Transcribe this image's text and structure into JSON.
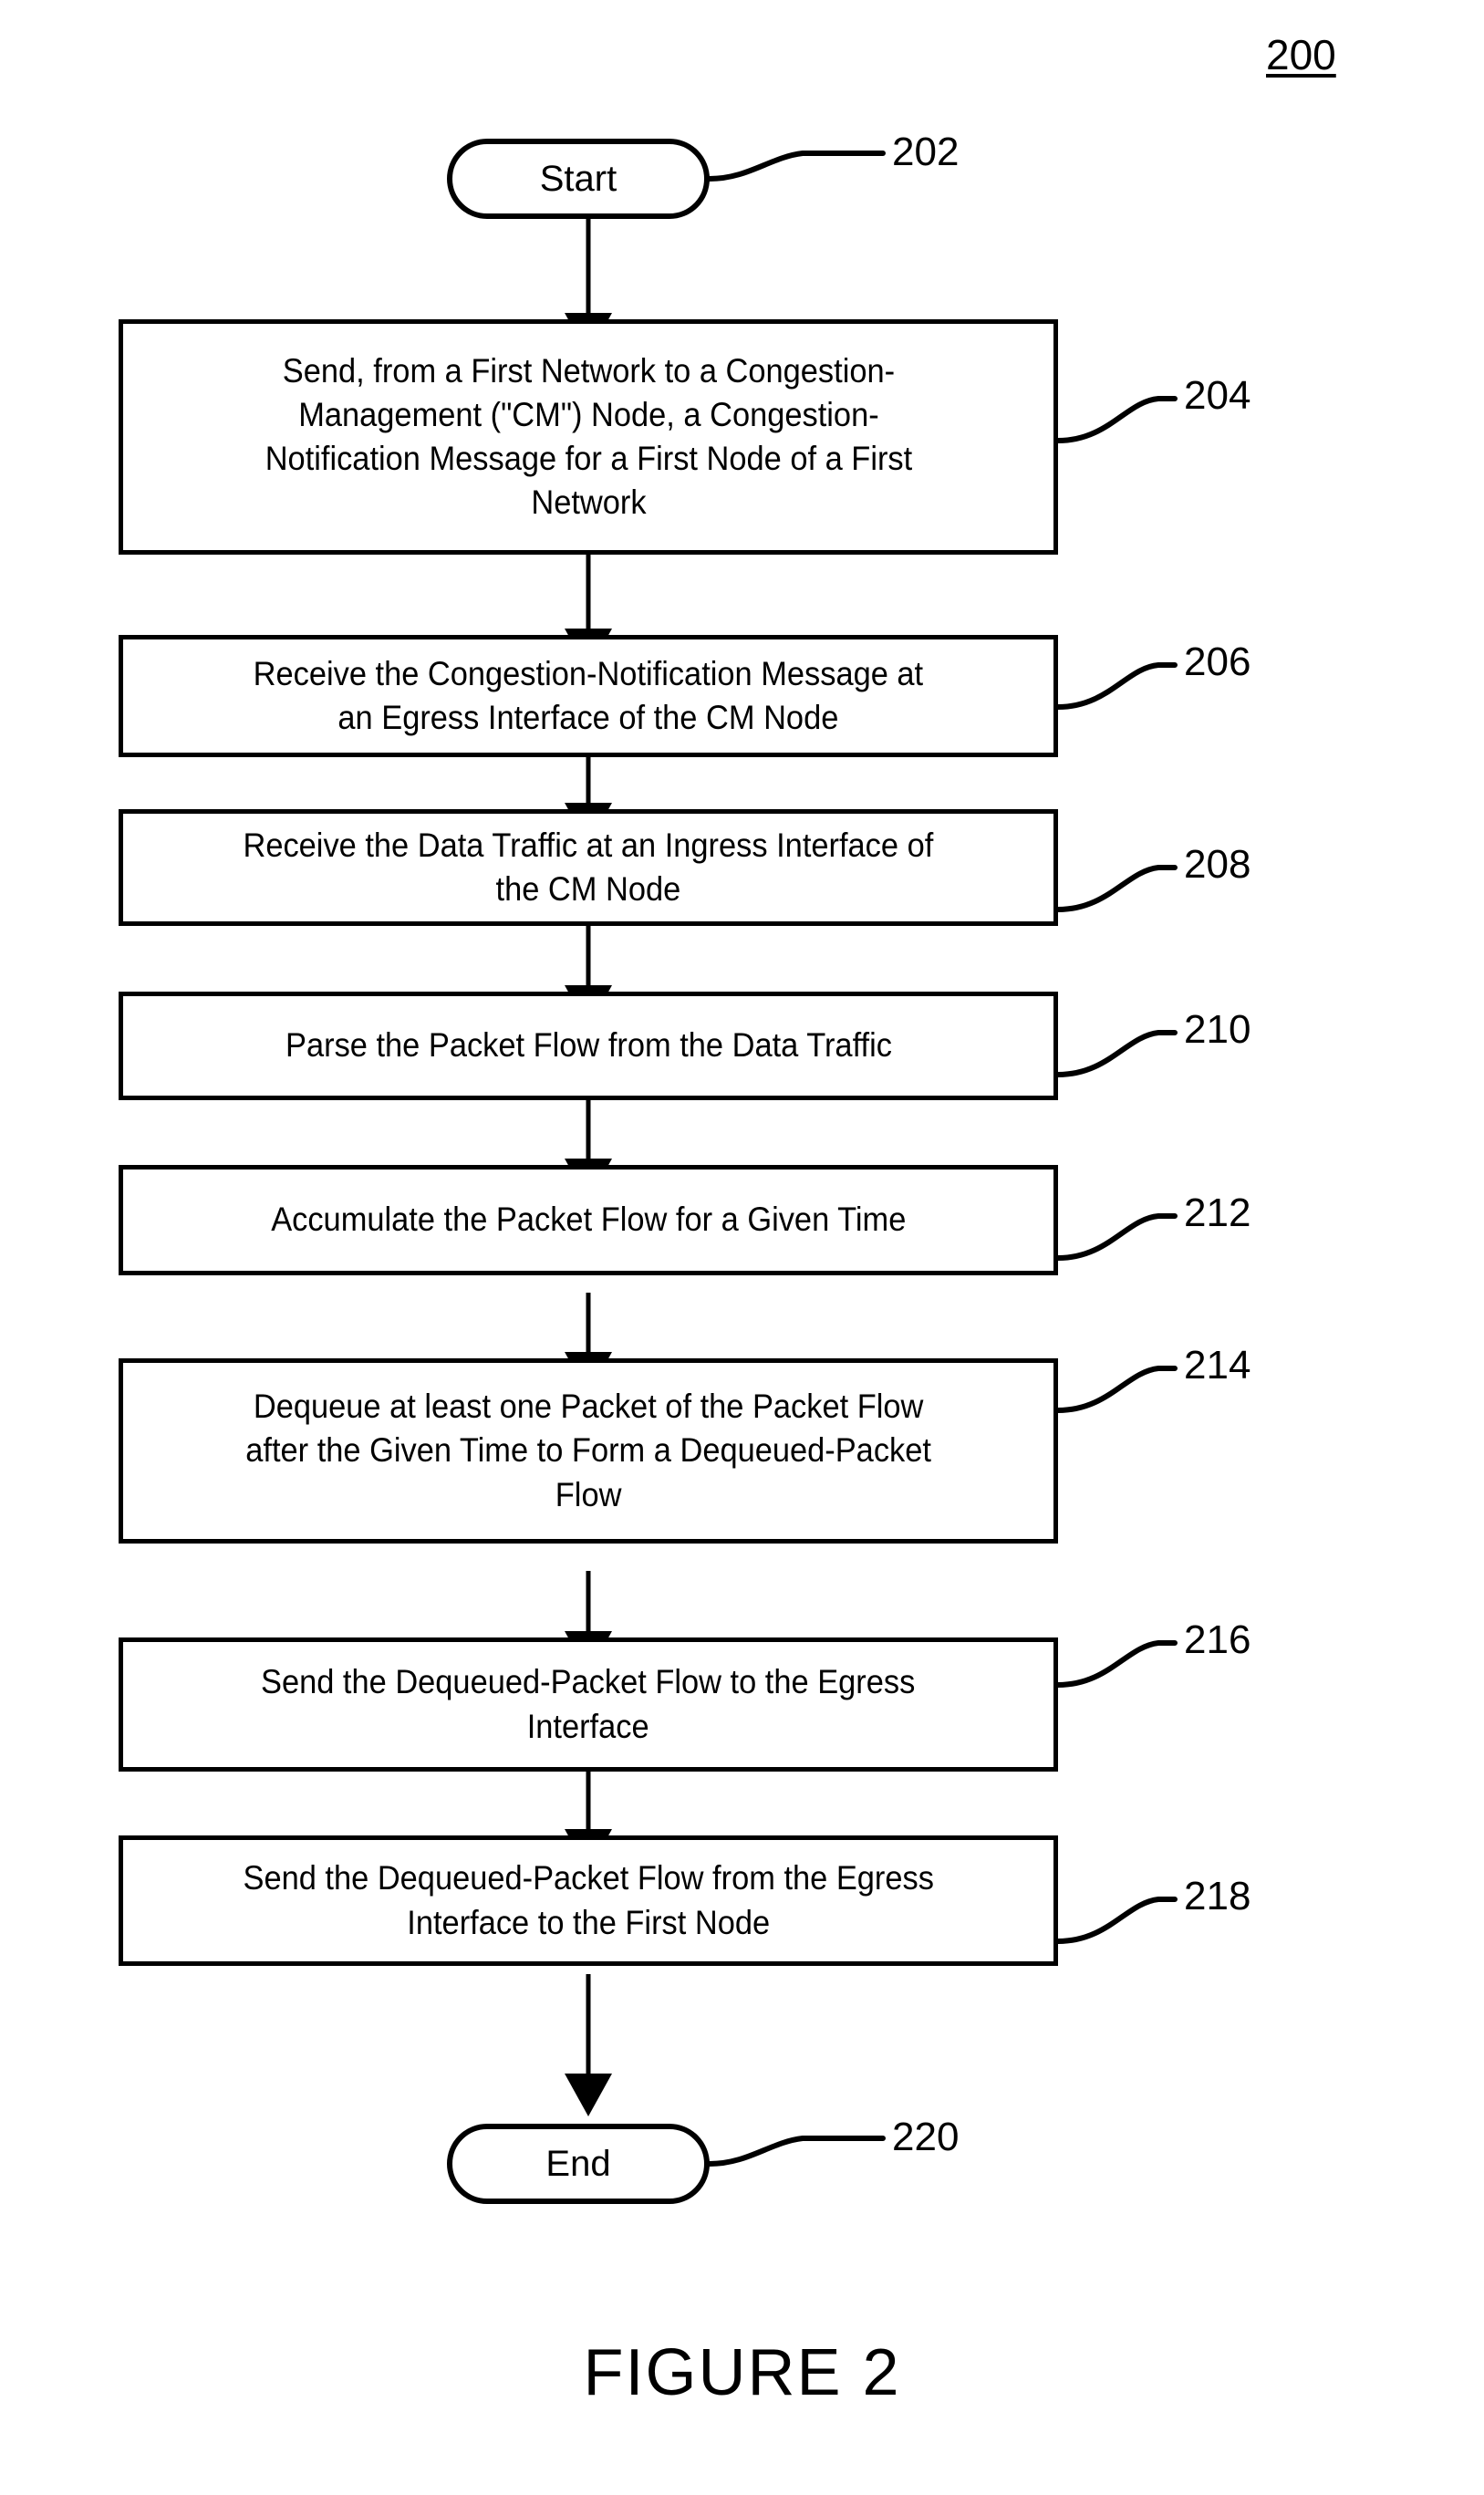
{
  "figure": {
    "number_label": "200",
    "caption": "FIGURE 2"
  },
  "nodes": {
    "start": {
      "label": "Start",
      "ref": "202"
    },
    "end": {
      "label": "End",
      "ref": "220"
    }
  },
  "steps": [
    {
      "ref": "204",
      "lines": [
        "Send, from a First Network to a Congestion-",
        "Management (\"CM\") Node, a Congestion-",
        "Notification Message for a First Node of a First",
        "Network"
      ]
    },
    {
      "ref": "206",
      "lines": [
        "Receive the Congestion-Notification Message at",
        "an Egress Interface of the CM Node"
      ]
    },
    {
      "ref": "208",
      "lines": [
        "Receive the Data Traffic at an Ingress Interface of",
        "the CM Node"
      ]
    },
    {
      "ref": "210",
      "lines": [
        "Parse the Packet Flow from the Data Traffic"
      ]
    },
    {
      "ref": "212",
      "lines": [
        "Accumulate the Packet Flow for a Given Time"
      ]
    },
    {
      "ref": "214",
      "lines": [
        "Dequeue at least one Packet of the Packet Flow",
        "after the Given Time to Form a Dequeued-Packet",
        "Flow"
      ]
    },
    {
      "ref": "216",
      "lines": [
        "Send the Dequeued-Packet Flow to the Egress",
        "Interface"
      ]
    },
    {
      "ref": "218",
      "lines": [
        "Send the Dequeued-Packet Flow from the Egress",
        "Interface to the First Node"
      ]
    }
  ],
  "colors": {
    "stroke": "#000000",
    "background": "#ffffff"
  }
}
